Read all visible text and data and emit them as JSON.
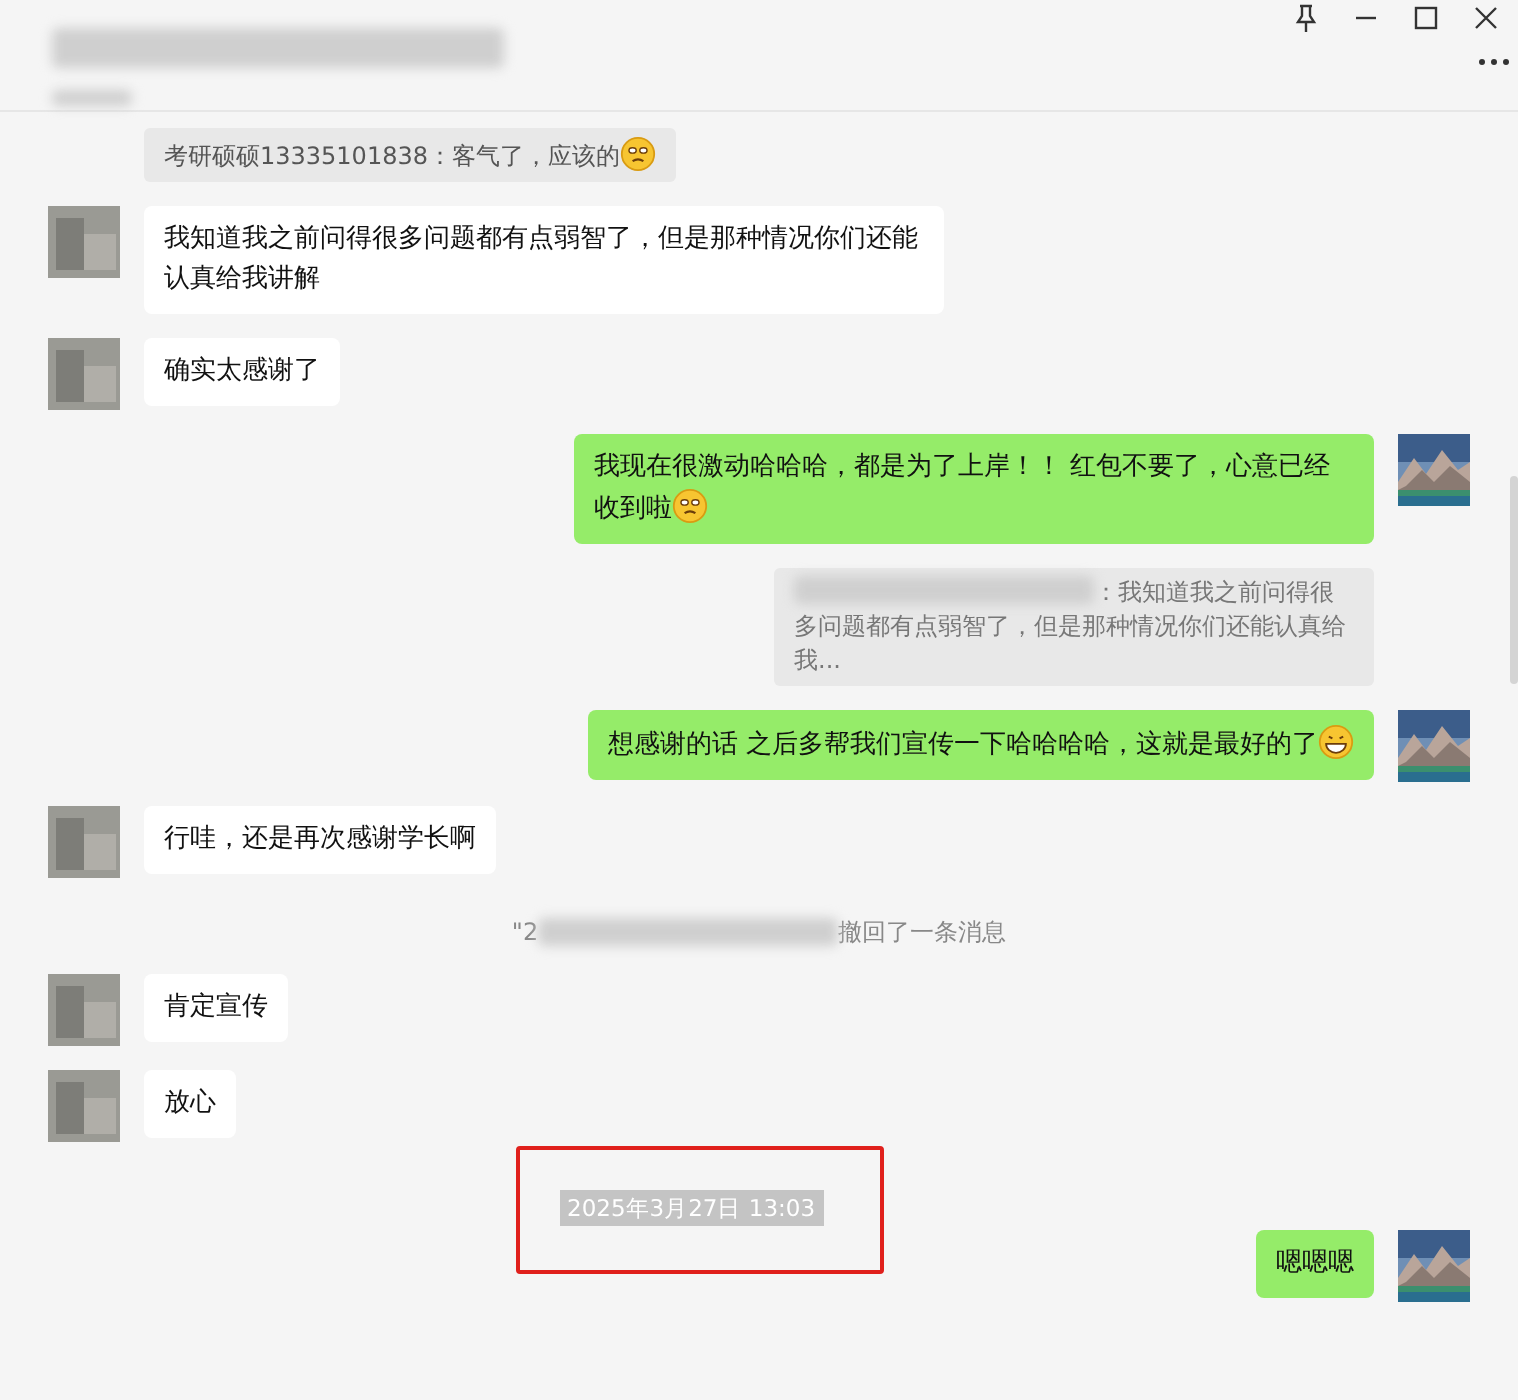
{
  "messages": [
    {
      "kind": "quote",
      "text": "考研硕硕13335101838：客气了，应该的",
      "emoji": {
        "kind": "smirk"
      }
    },
    {
      "kind": "text",
      "outgoing": false,
      "text": "我知道我之前问得很多问题都有点弱智了，但是那种情况你们还能认真给我讲解"
    },
    {
      "kind": "text",
      "outgoing": false,
      "text": "确实太感谢了"
    },
    {
      "kind": "text",
      "outgoing": true,
      "text": "我现在很激动哈哈哈，都是为了上岸！！ 红包不要了，心意已经收到啦",
      "emoji": {
        "kind": "smirk"
      }
    },
    {
      "kind": "reply-quote",
      "text": "：我知道我之前问得很多问题都有点弱智了，但是那种情况你们还能认真给我..."
    },
    {
      "kind": "text",
      "outgoing": true,
      "text": "想感谢的话 之后多帮我们宣传一下哈哈哈哈，这就是最好的了",
      "emoji": {
        "kind": "grin"
      }
    },
    {
      "kind": "text",
      "outgoing": false,
      "text": "行哇，还是再次感谢学长啊"
    },
    {
      "kind": "recall",
      "prefix": "\"2",
      "text": "撤回了一条消息"
    },
    {
      "kind": "text",
      "outgoing": false,
      "text": "肯定宣传"
    },
    {
      "kind": "text",
      "outgoing": false,
      "text": "放心"
    },
    {
      "kind": "time",
      "text": "2025年3月27日 13:03",
      "highlighted": true
    },
    {
      "kind": "text",
      "outgoing": true,
      "text": "嗯嗯嗯"
    }
  ]
}
